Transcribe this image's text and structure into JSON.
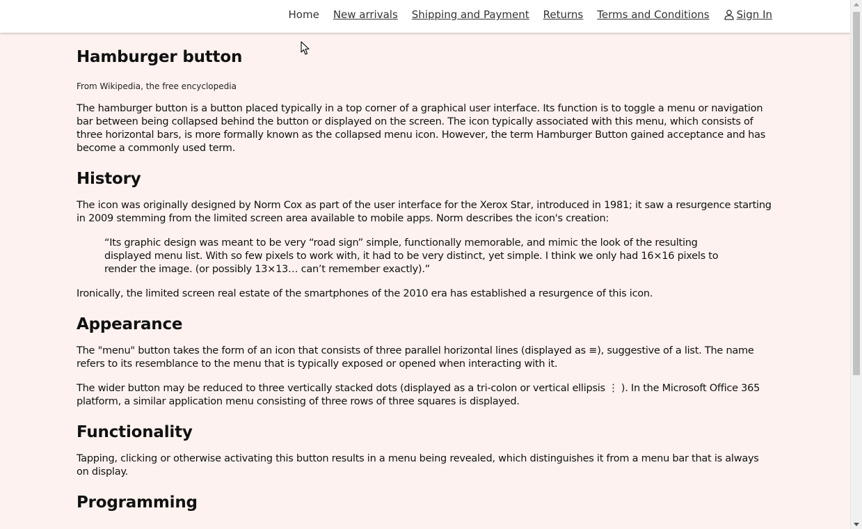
{
  "nav": {
    "home": "Home",
    "new_arrivals": "New arrivals",
    "shipping": "Shipping and Payment",
    "returns": "Returns",
    "terms": "Terms and Conditions",
    "sign_in": "Sign In",
    "sign_in_icon": "user-icon"
  },
  "article": {
    "title": "Hamburger button",
    "subtitle": "From Wikipedia, the free encyclopedia",
    "intro": "The hamburger button is a button placed typically in a top corner of a graphical user interface. Its function is to toggle a menu or navigation bar between being collapsed behind the button or displayed on the screen. The icon typically associated with this menu, which consists of three horizontal bars, is more formally known as the collapsed menu icon. However, the term Hamburger Button gained acceptance and has become a commonly used term.",
    "history_heading": "History",
    "history_p1": "The icon was originally designed by Norm Cox as part of the user interface for the Xerox Star, introduced in 1981; it saw a resurgence starting in 2009 stemming from the limited screen area available to mobile apps. Norm describes the icon's creation:",
    "history_quote": "“Its graphic design was meant to be very “road sign” simple, functionally memorable, and mimic the look of the resulting displayed menu list. With so few pixels to work with, it had to be very distinct, yet simple. I think we only had 16×16 pixels to render the image. (or possibly 13×13… can’t remember exactly).”",
    "history_p2": "Ironically, the limited screen real estate of the smartphones of the 2010 era has established a resurgence of this icon.",
    "appearance_heading": "Appearance",
    "appearance_p1": "The \"menu\" button takes the form of an icon that consists of three parallel horizontal lines (displayed as ≡), suggestive of a list. The name refers to its resemblance to the menu that is typically exposed or opened when interacting with it.",
    "appearance_p2": "The wider button may be reduced to three vertically stacked dots (displayed as a tri-colon or vertical ellipsis ⋮ ). In the Microsoft Office 365 platform, a similar application menu consisting of three rows of three squares is displayed.",
    "functionality_heading": "Functionality",
    "functionality_p1": "Tapping, clicking or otherwise activating this button results in a menu being revealed, which distinguishes it from a menu bar that is always on display.",
    "programming_heading": "Programming"
  },
  "colors": {
    "page_background": "#fdf2ef",
    "header_background": "#ffffff",
    "text": "#111111"
  }
}
